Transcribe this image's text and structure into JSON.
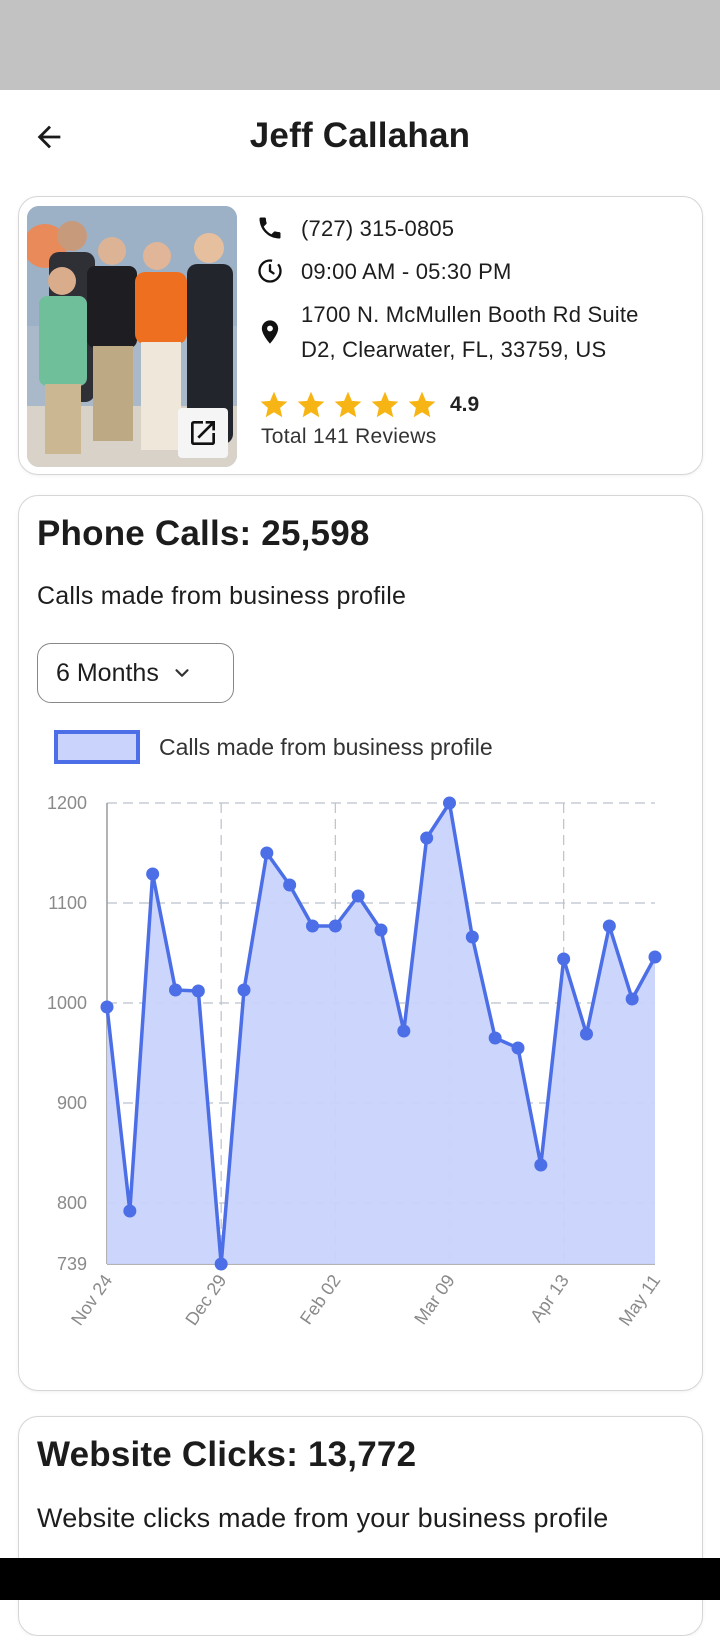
{
  "header": {
    "title": "Jeff Callahan"
  },
  "business": {
    "phone": "(727) 315-0805",
    "hours": "09:00 AM - 05:30 PM",
    "address_line1": "1700 N. McMullen Booth Rd Suite",
    "address_line2": "D2, Clearwater, FL, 33759, US",
    "rating": "4.9",
    "stars": 5,
    "reviews": "Total 141 Reviews"
  },
  "calls": {
    "title": "Phone Calls: 25,598",
    "subtitle": "Calls made from business profile",
    "range": "6 Months"
  },
  "chart_data": {
    "type": "area",
    "legend": "Calls made from business profile",
    "legend_position": "top-left",
    "grid": true,
    "x_ticks": [
      "Nov 24",
      "Dec 29",
      "Feb 02",
      "Mar 09",
      "Apr 13",
      "May 11"
    ],
    "x_tick_index": [
      0,
      5,
      10,
      15,
      20,
      24
    ],
    "y_ticks": [
      "739",
      "800",
      "900",
      "1000",
      "1100",
      "1200"
    ],
    "ylim": [
      739,
      1200
    ],
    "series": [
      {
        "name": "Calls made from business profile",
        "values": [
          996,
          792,
          1129,
          1013,
          1012,
          739,
          1013,
          1150,
          1118,
          1077,
          1077,
          1107,
          1073,
          972,
          1165,
          1200,
          1066,
          965,
          955,
          838,
          1044,
          969,
          1077,
          1004,
          1046
        ]
      }
    ],
    "colors": {
      "line": "#4c6ee6",
      "fill": "#c9d3fb"
    }
  },
  "web": {
    "title": "Website Clicks: 13,772",
    "subtitle": "Website clicks made from your business profile"
  }
}
